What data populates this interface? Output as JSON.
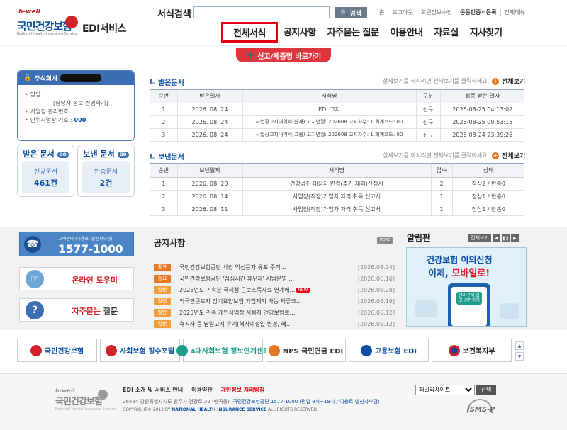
{
  "header": {
    "logo": {
      "hwell": "h-well",
      "name": "국민건강보험",
      "sub": "National Health Insurance Service"
    },
    "service_title": "EDI서비스",
    "search_label": "서식검색",
    "search_value": "",
    "search_button": "검색",
    "util_links": [
      "홈",
      "로그아웃",
      "회원정보수정",
      "공동인증서등록",
      "전체메뉴"
    ],
    "nav": [
      "전체서식",
      "공지사항",
      "자주묻는 질문",
      "이용안내",
      "자료실",
      "지사찾기"
    ],
    "report_button": "신고/제증명 바로가기"
  },
  "company": {
    "title": "주식회사",
    "items": [
      {
        "label": "담당 :",
        "value": ""
      },
      {
        "label": "[담당자 정보 변경하기]",
        "value": ""
      },
      {
        "label": "사업장 관리번호 :",
        "value": ""
      },
      {
        "label": "단위사업장 기호 :",
        "value": "000"
      }
    ]
  },
  "doc_boxes": {
    "received": {
      "title": "받은 문서",
      "go": "GO",
      "label": "신규문서",
      "count": "461건"
    },
    "sent": {
      "title": "보낸 문서",
      "go": "GO",
      "label": "반송문서",
      "count": "2건"
    }
  },
  "received": {
    "title": "받은문서",
    "hint": "상세보기를 하시려면 전체보기를 클릭하세요.",
    "view_all": "전체보기",
    "columns": [
      "순번",
      "받은일자",
      "서식명",
      "구분",
      "최종 받은 일자"
    ],
    "rows": [
      [
        "1",
        "2026. 08. 24",
        "EDI 고지",
        "신규",
        "2026-08-25 04:13:02"
      ],
      [
        "2",
        "2026. 08. 24",
        "사업장고지내역서(산재) 고지년월: 202608 고지차수: 1 회계코드: 00",
        "신규",
        "2026-08-25 00:53:15"
      ],
      [
        "3",
        "2026. 08. 24",
        "사업장고지내역서(고용) 고지년월: 202608 고지차수: 1 회계코드: 00",
        "신규",
        "2026-08-24 23:39:26"
      ]
    ]
  },
  "sent": {
    "title": "보낸문서",
    "hint": "상세보기를 하시려면 전체보기를 클릭하세요.",
    "view_all": "전체보기",
    "columns": [
      "순번",
      "보낸일자",
      "서식명",
      "접수",
      "상태"
    ],
    "rows": [
      [
        "1",
        "2026. 08. 20",
        "건강검진 대상자 변경(추가,제외)신청서",
        "2",
        "정상2 / 반송0"
      ],
      [
        "2",
        "2026. 08. 14",
        "사업장(직장)가입자 자격 취득 신고서",
        "1",
        "정상1 / 반송0"
      ],
      [
        "3",
        "2026. 08. 11",
        "사업장(직장)가입자 자격 취득 신고서",
        "1",
        "정상1 / 반송0"
      ]
    ]
  },
  "callcenter": {
    "label": "고객센터 (이용료: 발신자부담)",
    "number": "1577-1000"
  },
  "help": {
    "online": "온라인 도우미",
    "faq_red": "자주묻는",
    "faq_rest": " 질문"
  },
  "notice": {
    "title": "공지사항",
    "more": "MORE",
    "items": [
      {
        "tag": "중요",
        "type": "imp",
        "text": "국민건강보험공단 사칭 악성문자 유포 주의...",
        "new": "",
        "date": "[2026.08.24]"
      },
      {
        "tag": "중요",
        "type": "imp",
        "text": "국민건강보험공단 '점심시간 휴무제' 시범운영 ...",
        "new": "",
        "date": "[2026.06.16]"
      },
      {
        "tag": "일반",
        "type": "gen",
        "text": "2025년도 귀속분 국세청 근로소득자료 연계에...",
        "new": "NEW",
        "date": "[2026.08.28]"
      },
      {
        "tag": "일반",
        "type": "gen",
        "text": "외국인근로자 장기요양보험 가입제외 가능 체류코...",
        "new": "",
        "date": "[2026.05.19]"
      },
      {
        "tag": "일반",
        "type": "gen",
        "text": "2025년도 귀속 개인사업장 사용자 건강보험료...",
        "new": "",
        "date": "[2026.05.12]"
      },
      {
        "tag": "일반",
        "type": "gen",
        "text": "휴직자 등 납입고지 유예(해지예정일 변경, 해...",
        "new": "",
        "date": "[2026.05.12]"
      }
    ]
  },
  "alarm": {
    "title": "알림판",
    "view_all": "전체보기",
    "banner_line1": "건강보험 이의신청",
    "banner_line2_a": "이제, ",
    "banner_line2_b": "모바일로!",
    "banner_pill": "관리구제 쉽고 간편하게"
  },
  "related_sites": [
    {
      "name": "국민건강보험",
      "color": "#d2232a"
    },
    {
      "name": "사회보험 징수포털",
      "color": "#d2232a"
    },
    {
      "name": "4대사회보험 정보연계센터",
      "color": "#1e9d8b"
    },
    {
      "name": "NPS 국민연금 EDI",
      "color": "#e87722"
    },
    {
      "name": "고용보험 EDI",
      "color": "#0b4ea2"
    },
    {
      "name": "보건복지부",
      "color": "#1f3f8f"
    }
  ],
  "footer": {
    "logo": {
      "hwell": "h-well",
      "name": "국민건강보험",
      "sub": "National Health Insurance Service"
    },
    "links": [
      "EDI 소개 및 서비스 안내",
      "이용약관",
      "개인정보 처리방침"
    ],
    "address": "26464 강원특별자치도 원주시 건강로 32 (반곡동)",
    "contact": "국민건강보험공단 1577-1000 (평일 9시~18시 / 이용료:발신자부담)",
    "copy_a": "COPYRIGHT© 2012 BY ",
    "copy_b": "NATIONAL HEALTH INSURANCE SERVICE",
    "copy_c": " ALL RIGHTS RESERVED.",
    "family_site": "패밀리사이트",
    "family_button": "선택",
    "isms": "ISMS-P"
  },
  "colors": {
    "brand_blue": "#0b4ea2",
    "brand_red": "#d2232a",
    "accent_orange": "#e87722"
  }
}
